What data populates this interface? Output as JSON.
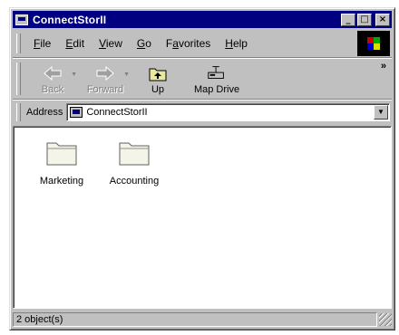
{
  "window": {
    "title": "ConnectStorII",
    "controls": {
      "minimize": "_",
      "maximize": "□",
      "close": "×"
    }
  },
  "menubar": {
    "items": [
      {
        "label": "File",
        "accel": "F",
        "rest": "ile"
      },
      {
        "label": "Edit",
        "accel": "E",
        "rest": "dit"
      },
      {
        "label": "View",
        "accel": "V",
        "rest": "iew"
      },
      {
        "label": "Go",
        "accel": "G",
        "rest": "o"
      },
      {
        "label": "Favorites",
        "accel": "a",
        "pre": "F",
        "rest": "vorites"
      },
      {
        "label": "Help",
        "accel": "H",
        "rest": "elp"
      }
    ]
  },
  "toolbar": {
    "back_label": "Back",
    "forward_label": "Forward",
    "up_label": "Up",
    "map_drive_label": "Map Drive",
    "chevron": "»",
    "icons": {
      "back": "back-arrow-icon",
      "forward": "forward-arrow-icon",
      "up": "up-folder-icon",
      "map_drive": "map-drive-icon"
    }
  },
  "address": {
    "label": "Address",
    "value": "ConnectStorII",
    "icon": "drive-icon"
  },
  "folders": [
    {
      "name": "Marketing",
      "icon": "folder-icon"
    },
    {
      "name": "Accounting",
      "icon": "folder-icon"
    }
  ],
  "status": {
    "text": "2 object(s)"
  },
  "colors": {
    "titlebar": "#000080",
    "face": "#c0c0c0",
    "content": "#ffffff"
  }
}
